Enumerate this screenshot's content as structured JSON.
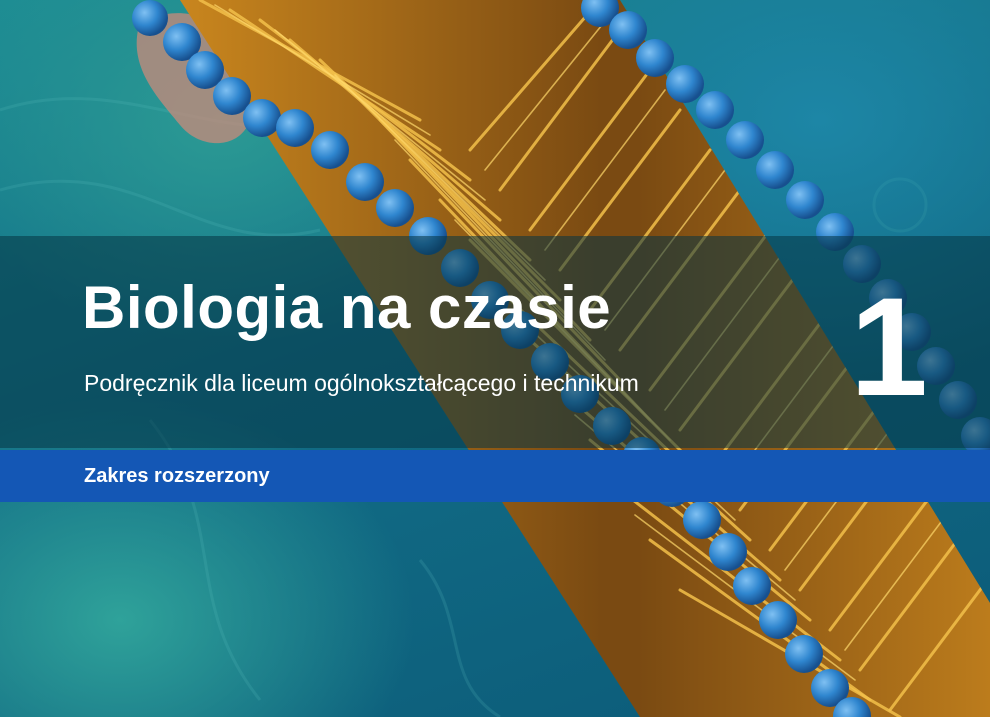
{
  "cover": {
    "title": "Biologia na czasie",
    "subtitle": "Podręcznik dla liceum ogólnokształcącego i technikum",
    "volume": "1",
    "range": "Zakres rozszerzony"
  },
  "illustration": "lipid-bilayer-membrane",
  "colors": {
    "background": "#126d86",
    "range_band": "#1457b5",
    "lipid_head": "#2f86cf",
    "lipid_tail": "#e0a233",
    "text": "#ffffff"
  }
}
